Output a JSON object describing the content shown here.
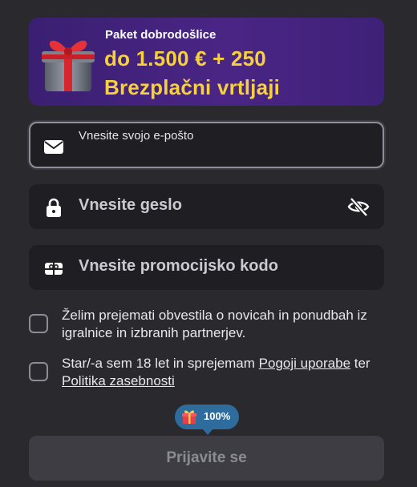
{
  "promo_banner": {
    "subtitle": "Paket dobrodošlice",
    "line1": "do 1.500 € + 250",
    "line2": "Brezplačni vrtljaji"
  },
  "form": {
    "email": {
      "label": "Vnesite svojo e-pošto",
      "value": ""
    },
    "password": {
      "placeholder": "Vnesite geslo"
    },
    "promo_code": {
      "placeholder": "Vnesite promocijsko kodo"
    }
  },
  "consents": {
    "newsletter": {
      "text": "Želim prejemati obvestila o novicah in ponudbah iz igralnice in izbranih partnerjev.",
      "checked": false
    },
    "terms": {
      "prefix": "Star/-a sem 18 let in sprejemam ",
      "terms_link": "Pogoji uporabe",
      "middle": " ter ",
      "privacy_link": "Politika zasebnosti",
      "checked": false
    }
  },
  "progress_badge": {
    "label": "100%",
    "value": 100
  },
  "submit_button": {
    "label": "Prijavite se"
  },
  "colors": {
    "background": "#2a2a2e",
    "banner": "#4a2585",
    "headline": "#f6d13c",
    "badge": "#2e6c9e"
  },
  "icons": [
    "gift-icon",
    "envelope-icon",
    "lock-icon",
    "eye-off-icon",
    "ticket-icon",
    "gift-mini-icon"
  ]
}
